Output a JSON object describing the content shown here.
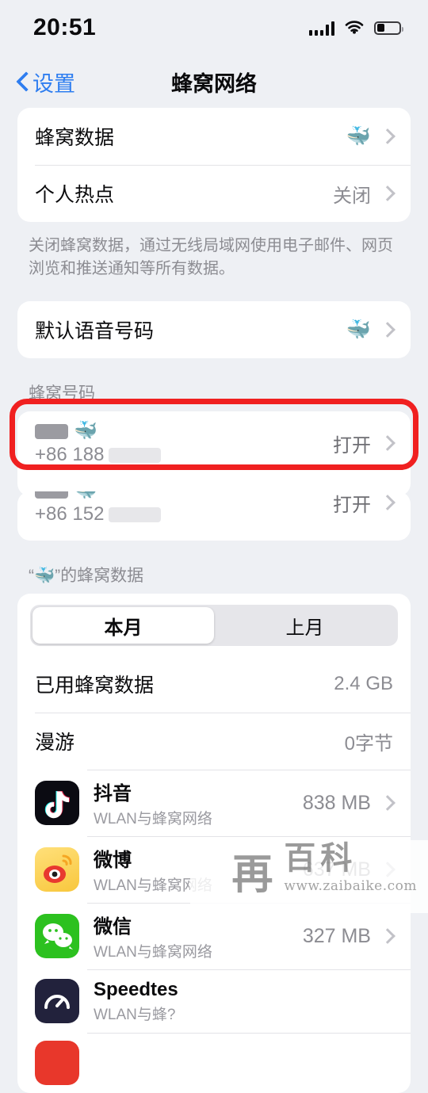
{
  "status_bar": {
    "time": "20:51",
    "signal_icon": "cellular-signal-icon",
    "wifi_icon": "wifi-icon",
    "battery_icon": "battery-low-icon"
  },
  "nav": {
    "back_label": "设置",
    "title": "蜂窝网络",
    "back_icon": "chevron-left-icon",
    "accent": "#2f7ef0"
  },
  "group1": {
    "rows": [
      {
        "title": "蜂窝数据",
        "value": "",
        "emoji": "🐳",
        "chevron": true
      },
      {
        "title": "个人热点",
        "value": "关闭",
        "emoji": "",
        "chevron": true
      }
    ],
    "footnote": "关闭蜂窝数据，通过无线局域网使用电子邮件、网页浏览和推送通知等所有数据。"
  },
  "group2": {
    "rows": [
      {
        "title": "默认语音号码",
        "value": "",
        "emoji": "🐳",
        "chevron": true
      }
    ]
  },
  "sim_section": {
    "header": "蜂窝号码",
    "rows": [
      {
        "emoji": "🐳",
        "number": "+86 188",
        "value": "打开",
        "redacted": true
      },
      {
        "emoji": "🐳",
        "number": "+86 152",
        "value": "打开",
        "redacted": true
      }
    ],
    "annotation_color": "#f02020"
  },
  "usage_section": {
    "header": "“🐳”的蜂窝数据",
    "segments": [
      {
        "label": "本月",
        "selected": true
      },
      {
        "label": "上月",
        "selected": false
      }
    ],
    "summary_rows": [
      {
        "title": "已用蜂窝数据",
        "value": "2.4 GB"
      },
      {
        "title": "漫游",
        "value": "0字节"
      }
    ],
    "apps": [
      {
        "name": "抖音",
        "sub": "WLAN与蜂窝网络",
        "size": "838 MB",
        "icon": "douyin-icon"
      },
      {
        "name": "微博",
        "sub": "WLAN与蜂窝网络",
        "size": "637 MB",
        "icon": "weibo-icon"
      },
      {
        "name": "微信",
        "sub": "WLAN与蜂窝网络",
        "size": "327 MB",
        "icon": "wechat-icon"
      },
      {
        "name": "Speedtes",
        "sub": "WLAN与蜂?",
        "size": "",
        "icon": "speedtest-icon"
      }
    ]
  },
  "watermark": {
    "seal": "再",
    "cn": "百科",
    "url": "www.zaibaike.com"
  }
}
